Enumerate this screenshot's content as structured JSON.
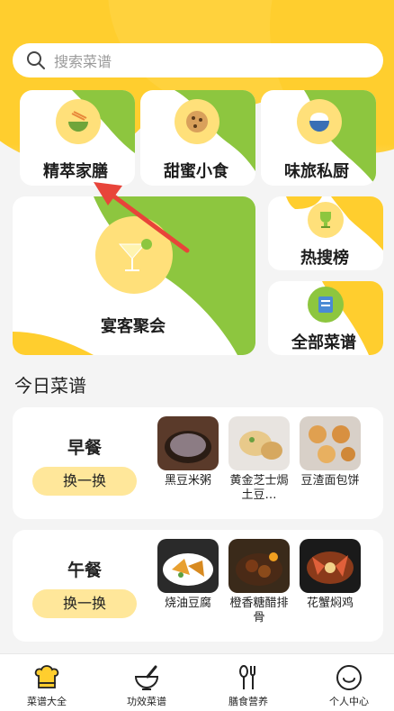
{
  "search": {
    "placeholder": "搜索菜谱"
  },
  "categories": [
    {
      "label": "精萃家膳",
      "icon": "bowl-food-icon"
    },
    {
      "label": "甜蜜小食",
      "icon": "cookie-icon"
    },
    {
      "label": "味旅私厨",
      "icon": "rice-bowl-icon"
    },
    {
      "label": "宴客聚会",
      "icon": "cocktail-icon"
    },
    {
      "label": "热搜榜",
      "icon": "trophy-icon"
    },
    {
      "label": "全部菜谱",
      "icon": "menu-book-icon"
    }
  ],
  "today": {
    "title": "今日菜谱",
    "swap_label": "换一换",
    "meals": [
      {
        "name": "早餐",
        "dishes": [
          "黑豆米粥",
          "黄金芝士焗土豆…",
          "豆渣面包饼"
        ]
      },
      {
        "name": "午餐",
        "dishes": [
          "烧油豆腐",
          "橙香糖醋排骨",
          "花蟹焖鸡"
        ]
      }
    ]
  },
  "tabs": [
    {
      "label": "菜谱大全",
      "icon": "chef-hat-icon",
      "active": true
    },
    {
      "label": "功效菜谱",
      "icon": "mortar-icon",
      "active": false
    },
    {
      "label": "膳食营养",
      "icon": "spoon-fork-icon",
      "active": false
    },
    {
      "label": "个人中心",
      "icon": "smile-face-icon",
      "active": false
    }
  ],
  "colors": {
    "accent_yellow": "#ffce2e",
    "accent_green": "#8dc63f",
    "arrow_red": "#e8443a"
  }
}
